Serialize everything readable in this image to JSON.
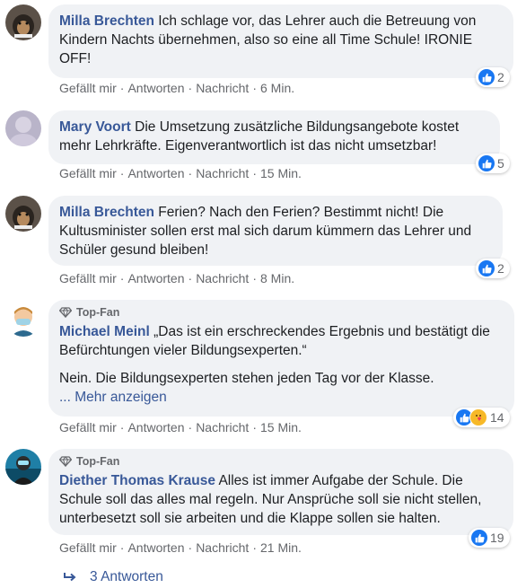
{
  "actions": {
    "like": "Gefällt mir",
    "reply": "Antworten",
    "message": "Nachricht",
    "separator": "·"
  },
  "comments": [
    {
      "author": "Milla Brechten",
      "text": "Ich schlage vor, das Lehrer auch die Betreuung von Kindern Nachts übernehmen, also so eine all Time Schule! IRONIE OFF!",
      "time": "6 Min.",
      "reaction_count": "2",
      "reactions": [
        "like"
      ]
    },
    {
      "author": "Mary Voort",
      "text": "Die Umsetzung zusätzliche Bildungsangebote kostet mehr Lehrkräfte. Eigenverantwortlich ist das nicht umsetzbar!",
      "time": "15 Min.",
      "reaction_count": "5",
      "reactions": [
        "like"
      ]
    },
    {
      "author": "Milla Brechten",
      "text": "Ferien? Nach den Ferien? Bestimmt nicht! Die Kultusminister sollen erst mal sich darum kümmern das Lehrer und Schüler gesund bleiben!",
      "time": "8 Min.",
      "reaction_count": "2",
      "reactions": [
        "like"
      ]
    },
    {
      "badge": "Top-Fan",
      "author": "Michael Meinl",
      "text": "„Das ist ein erschreckendes Ergebnis und bestätigt die Befürchtungen vieler Bildungsexperten.“",
      "text2": "Nein. Die Bildungsexperten stehen jeden Tag vor der Klasse.",
      "more": "... Mehr anzeigen",
      "time": "15 Min.",
      "reaction_count": "14",
      "reactions": [
        "like",
        "care"
      ]
    },
    {
      "badge": "Top-Fan",
      "author": "Diether Thomas Krause",
      "text": "Alles ist immer Aufgabe der Schule. Die Schule soll das alles mal regeln. Nur Ansprüche soll sie nicht stellen, unterbesetzt soll sie arbeiten und die Klappe sollen sie halten.",
      "time": "21 Min.",
      "reaction_count": "19",
      "reactions": [
        "like"
      ]
    }
  ],
  "replies_link": "3 Antworten",
  "colors": {
    "bubble": "#f0f2f5",
    "author": "#385898",
    "like": "#1877f2",
    "meta": "#65676b"
  },
  "icons": {
    "like": "thumbs-up-icon",
    "care": "care-icon",
    "badge": "diamond-icon",
    "replies": "reply-arrow-icon"
  }
}
